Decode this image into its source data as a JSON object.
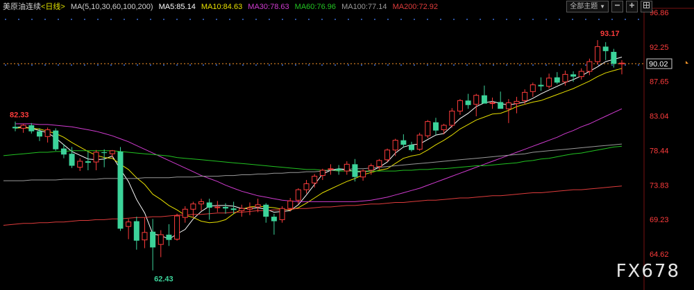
{
  "header": {
    "symbol": "美原油连续",
    "period": "<日线>",
    "ma_params": "MA(5,10,30,60,100,200)",
    "ma5": "MA5:85.14",
    "ma10": "MA10:84.63",
    "ma30": "MA30:78.63",
    "ma60": "MA60:76.96",
    "ma100": "MA100:77.14",
    "ma200": "MA200:72.92"
  },
  "toolbar": {
    "theme_label": "全部主题",
    "theme_arrow": "▼"
  },
  "watermark": "FX678",
  "colors": {
    "up": "#ff3c3c",
    "down": "#3cd39a",
    "ma5": "#ffffff",
    "ma10": "#e8e000",
    "ma30": "#d23cd2",
    "ma60": "#22c422",
    "ma100": "#9a9a9a",
    "ma200": "#e03c3c",
    "axis_text": "#ff3c3c",
    "grid": "#8a1a1a"
  },
  "chart_data": {
    "type": "candlestick",
    "title": "美原油连续 <日线>",
    "ylim": [
      64.62,
      96.86
    ],
    "y_ticks": [
      "96.86",
      "92.25",
      "87.65",
      "83.04",
      "78.44",
      "73.83",
      "69.23",
      "64.62"
    ],
    "current_price": "90.02",
    "high_label": "93.17",
    "low_label": "62.43",
    "start_label": "82.33",
    "candles": [
      [
        81.6,
        82.3,
        81.0,
        81.4
      ],
      [
        81.4,
        82.0,
        80.8,
        81.8
      ],
      [
        81.8,
        82.1,
        80.7,
        81.0
      ],
      [
        81.0,
        81.4,
        79.7,
        80.3
      ],
      [
        80.3,
        81.5,
        79.5,
        81.2
      ],
      [
        81.1,
        81.4,
        78.4,
        78.6
      ],
      [
        78.7,
        79.3,
        77.4,
        77.9
      ],
      [
        78.0,
        78.9,
        76.1,
        76.4
      ],
      [
        76.2,
        77.4,
        75.7,
        77.0
      ],
      [
        77.0,
        78.3,
        75.8,
        76.8
      ],
      [
        76.9,
        78.5,
        75.8,
        78.2
      ],
      [
        78.2,
        78.6,
        76.2,
        78.1
      ],
      [
        78.0,
        78.5,
        77.5,
        78.4
      ],
      [
        78.3,
        78.9,
        67.7,
        68.0
      ],
      [
        68.3,
        69.3,
        66.6,
        68.9
      ],
      [
        69.0,
        69.6,
        65.2,
        66.4
      ],
      [
        66.5,
        69.5,
        65.4,
        67.5
      ],
      [
        67.6,
        69.3,
        62.43,
        65.5
      ],
      [
        65.9,
        67.8,
        64.2,
        67.2
      ],
      [
        67.2,
        68.6,
        65.7,
        66.5
      ],
      [
        66.6,
        70.0,
        66.4,
        69.7
      ],
      [
        69.5,
        71.0,
        68.8,
        70.6
      ],
      [
        70.6,
        71.6,
        69.5,
        71.3
      ],
      [
        71.3,
        72.0,
        70.4,
        71.6
      ],
      [
        71.5,
        72.0,
        69.2,
        70.8
      ],
      [
        70.8,
        71.7,
        70.2,
        70.9
      ],
      [
        70.9,
        71.4,
        70.0,
        70.7
      ],
      [
        70.7,
        71.6,
        70.0,
        70.5
      ],
      [
        70.4,
        71.2,
        69.6,
        70.7
      ],
      [
        70.6,
        71.5,
        69.8,
        70.8
      ],
      [
        70.9,
        72.0,
        70.2,
        71.2
      ],
      [
        71.2,
        71.4,
        68.8,
        69.6
      ],
      [
        69.6,
        70.0,
        67.2,
        69.0
      ],
      [
        69.2,
        71.0,
        68.8,
        70.7
      ],
      [
        70.7,
        72.1,
        70.3,
        71.7
      ],
      [
        71.8,
        73.4,
        71.3,
        73.2
      ],
      [
        73.2,
        74.5,
        72.7,
        74.0
      ],
      [
        74.1,
        75.3,
        73.5,
        75.0
      ],
      [
        75.1,
        76.0,
        74.5,
        75.8
      ],
      [
        75.9,
        76.6,
        75.2,
        76.0
      ],
      [
        76.0,
        76.5,
        75.2,
        75.8
      ],
      [
        75.7,
        77.0,
        75.2,
        76.6
      ],
      [
        76.6,
        77.3,
        74.3,
        74.9
      ],
      [
        74.9,
        75.9,
        74.4,
        75.7
      ],
      [
        75.8,
        76.7,
        75.2,
        76.4
      ],
      [
        76.3,
        77.3,
        75.9,
        77.1
      ],
      [
        77.2,
        78.7,
        76.9,
        78.5
      ],
      [
        78.5,
        80.0,
        77.7,
        79.8
      ],
      [
        79.8,
        80.6,
        78.8,
        79.2
      ],
      [
        79.2,
        79.6,
        78.3,
        78.5
      ],
      [
        78.6,
        80.8,
        78.4,
        80.5
      ],
      [
        80.4,
        82.5,
        80.1,
        82.3
      ],
      [
        82.2,
        82.8,
        80.5,
        81.1
      ],
      [
        81.2,
        82.0,
        80.6,
        81.8
      ],
      [
        81.8,
        84.1,
        81.5,
        83.7
      ],
      [
        83.7,
        85.3,
        83.2,
        85.1
      ],
      [
        85.1,
        86.0,
        84.0,
        84.5
      ],
      [
        84.6,
        86.0,
        83.0,
        85.8
      ],
      [
        85.8,
        87.1,
        84.9,
        84.7
      ],
      [
        84.7,
        85.5,
        84.0,
        84.8
      ],
      [
        84.9,
        86.3,
        84.3,
        84.0
      ],
      [
        84.0,
        85.3,
        82.1,
        84.8
      ],
      [
        84.7,
        85.6,
        83.4,
        85.0
      ],
      [
        85.1,
        86.6,
        84.6,
        86.2
      ],
      [
        86.3,
        87.5,
        85.6,
        87.2
      ],
      [
        87.2,
        88.2,
        86.4,
        87.0
      ],
      [
        87.0,
        88.7,
        86.7,
        88.1
      ],
      [
        88.2,
        88.9,
        87.3,
        87.5
      ],
      [
        87.6,
        89.1,
        87.1,
        88.6
      ],
      [
        88.6,
        89.0,
        87.6,
        88.3
      ],
      [
        88.3,
        89.4,
        87.9,
        89.0
      ],
      [
        89.0,
        90.7,
        88.5,
        90.3
      ],
      [
        90.3,
        93.17,
        89.9,
        92.3
      ],
      [
        92.3,
        92.9,
        90.5,
        91.7
      ],
      [
        91.6,
        92.0,
        89.5,
        90.0
      ],
      [
        90.0,
        90.5,
        88.6,
        90.1
      ]
    ],
    "series": [
      {
        "name": "MA5",
        "values": [
          81.5,
          81.6,
          81.4,
          81.1,
          80.8,
          80.1,
          79.2,
          78.3,
          77.8,
          77.3,
          77.2,
          77.3,
          77.7,
          75.9,
          74.3,
          71.9,
          70.1,
          67.3,
          67.1,
          66.6,
          67.3,
          67.9,
          69.3,
          70.3,
          71.0,
          71.1,
          71.1,
          71.0,
          70.7,
          70.7,
          70.8,
          70.6,
          70.2,
          70.3,
          70.4,
          71.2,
          72.5,
          73.9,
          75.3,
          75.8,
          76.0,
          75.9,
          75.6,
          75.6,
          75.7,
          76.2,
          76.9,
          78.1,
          78.9,
          79.2,
          79.3,
          79.9,
          80.5,
          80.7,
          81.7,
          82.7,
          83.4,
          84.3,
          84.8,
          85.0,
          84.7,
          84.5,
          84.7,
          84.9,
          85.4,
          86.0,
          86.5,
          87.0,
          87.5,
          87.9,
          88.4,
          89.0,
          89.6,
          90.3,
          90.6,
          90.9
        ]
      },
      {
        "name": "MA10",
        "values": [
          81.4,
          81.5,
          81.4,
          81.3,
          81.0,
          80.7,
          80.2,
          79.5,
          78.9,
          78.3,
          77.8,
          77.5,
          77.4,
          76.6,
          75.9,
          74.8,
          73.9,
          72.6,
          71.9,
          71.1,
          70.5,
          69.8,
          69.5,
          69.0,
          68.8,
          68.9,
          69.2,
          70.0,
          70.6,
          70.9,
          71.0,
          70.9,
          70.8,
          70.6,
          70.5,
          70.8,
          71.4,
          72.1,
          72.8,
          73.3,
          73.8,
          74.3,
          74.7,
          75.2,
          75.5,
          75.8,
          76.0,
          76.7,
          77.4,
          77.7,
          77.9,
          78.5,
          79.2,
          79.8,
          80.5,
          81.3,
          81.9,
          82.5,
          82.9,
          83.3,
          83.4,
          83.8,
          84.3,
          84.6,
          84.9,
          85.1,
          85.5,
          85.9,
          86.3,
          86.7,
          87.2,
          87.7,
          88.3,
          88.8,
          89.1,
          89.4
        ]
      },
      {
        "name": "MA30",
        "values": [
          82.0,
          82.0,
          82.0,
          81.9,
          81.9,
          81.8,
          81.7,
          81.6,
          81.4,
          81.2,
          81.0,
          80.7,
          80.4,
          80.0,
          79.6,
          79.1,
          78.6,
          78.1,
          77.6,
          77.1,
          76.6,
          76.1,
          75.6,
          75.1,
          74.7,
          74.3,
          73.8,
          73.4,
          73.0,
          72.7,
          72.4,
          72.2,
          72.0,
          71.8,
          71.7,
          71.6,
          71.6,
          71.6,
          71.6,
          71.6,
          71.6,
          71.6,
          71.6,
          71.7,
          71.8,
          72.0,
          72.2,
          72.5,
          72.8,
          73.1,
          73.4,
          73.8,
          74.2,
          74.6,
          75.0,
          75.4,
          75.8,
          76.2,
          76.6,
          77.0,
          77.4,
          77.8,
          78.2,
          78.6,
          79.0,
          79.4,
          79.8,
          80.2,
          80.7,
          81.1,
          81.6,
          82.0,
          82.5,
          83.0,
          83.5,
          84.0
        ]
      },
      {
        "name": "MA60",
        "values": [
          77.9,
          78.0,
          78.1,
          78.2,
          78.2,
          78.3,
          78.3,
          78.4,
          78.4,
          78.4,
          78.4,
          78.4,
          78.4,
          78.3,
          78.2,
          78.1,
          78.0,
          77.9,
          77.8,
          77.7,
          77.5,
          77.4,
          77.3,
          77.2,
          77.1,
          77.0,
          76.9,
          76.8,
          76.7,
          76.6,
          76.5,
          76.4,
          76.3,
          76.2,
          76.1,
          76.0,
          75.9,
          75.9,
          75.8,
          75.8,
          75.7,
          75.7,
          75.7,
          75.7,
          75.7,
          75.7,
          75.7,
          75.7,
          75.8,
          75.8,
          75.9,
          75.9,
          76.0,
          76.0,
          76.1,
          76.2,
          76.3,
          76.4,
          76.4,
          76.5,
          76.6,
          76.7,
          76.8,
          77.0,
          77.1,
          77.3,
          77.4,
          77.6,
          77.8,
          78.0,
          78.1,
          78.3,
          78.5,
          78.7,
          78.9,
          79.0
        ]
      },
      {
        "name": "MA100",
        "values": [
          74.4,
          74.4,
          74.5,
          74.5,
          74.5,
          74.5,
          74.6,
          74.6,
          74.6,
          74.6,
          74.6,
          74.7,
          74.7,
          74.7,
          74.7,
          74.7,
          74.8,
          74.8,
          74.8,
          74.8,
          74.9,
          74.9,
          74.9,
          75.0,
          75.0,
          75.0,
          75.1,
          75.1,
          75.2,
          75.2,
          75.3,
          75.3,
          75.4,
          75.4,
          75.5,
          75.5,
          75.6,
          75.6,
          75.7,
          75.8,
          75.8,
          75.9,
          76.0,
          76.0,
          76.1,
          76.2,
          76.3,
          76.4,
          76.5,
          76.6,
          76.7,
          76.8,
          76.9,
          77.0,
          77.1,
          77.2,
          77.3,
          77.4,
          77.5,
          77.6,
          77.7,
          77.8,
          77.9,
          78.0,
          78.2,
          78.3,
          78.4,
          78.5,
          78.6,
          78.7,
          78.8,
          78.9,
          79.0,
          79.1,
          79.2,
          79.3
        ]
      },
      {
        "name": "MA200",
        "values": [
          68.6,
          68.7,
          68.7,
          68.8,
          68.8,
          68.9,
          68.9,
          69.0,
          69.1,
          69.1,
          69.2,
          69.2,
          69.3,
          69.3,
          69.4,
          69.5,
          69.5,
          69.6,
          69.6,
          69.7,
          69.8,
          69.8,
          69.9,
          69.9,
          70.0,
          70.1,
          70.1,
          70.2,
          70.2,
          70.3,
          70.4,
          70.4,
          70.5,
          70.5,
          70.6,
          70.7,
          70.7,
          70.8,
          70.9,
          70.9,
          71.0,
          71.1,
          71.1,
          71.2,
          71.3,
          71.3,
          71.4,
          71.5,
          71.5,
          71.6,
          71.7,
          71.8,
          71.8,
          71.9,
          72.0,
          72.1,
          72.1,
          72.2,
          72.3,
          72.4,
          72.4,
          72.5,
          72.6,
          72.7,
          72.8,
          72.8,
          72.9,
          73.0,
          73.1,
          73.2,
          73.2,
          73.3,
          73.4,
          73.5,
          73.6,
          73.7
        ]
      }
    ]
  }
}
